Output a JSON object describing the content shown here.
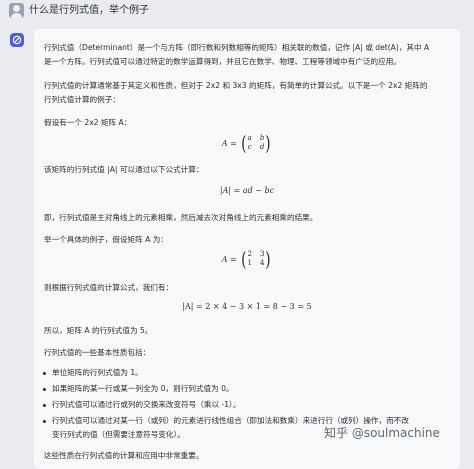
{
  "user_message": "什么是行列式值，举个例子",
  "response": {
    "intro_line1": "行列式值（Determinant）是一个与方阵（即行数和列数相等的矩阵）相关联的数值，记作 |A| 或 det(A)，其中 A",
    "intro_line2": "是一个方阵。行列式值可以通过特定的数学运算得到，并且它在数学、物理、工程等领域中有广泛的应用。",
    "calc_line1": "行列式值的计算通常基于其定义和性质，但对于 2x2 和 3x3 的矩阵，有简单的计算公式。以下是一个 2x2 矩阵的",
    "calc_line2": "行列式值计算的例子：",
    "assume": "假设有一个 2x2 矩阵 A：",
    "matrix_generic": {
      "lhs": "A =",
      "a": "a",
      "b": "b",
      "c": "c",
      "d": "d"
    },
    "formula_intro": "该矩阵的行列式值 |A| 可以通过以下公式计算：",
    "formula_generic": "|A| = ad − bc",
    "explain": "即，行列式值是主对角线上的元素相乘，然后减去次对角线上的元素相乘的结果。",
    "example_intro": "举一个具体的例子，假设矩阵 A 为：",
    "matrix_example": {
      "lhs": "A =",
      "a": "2",
      "b": "3",
      "c": "1",
      "d": "4"
    },
    "calc_intro": "则根据行列式值的计算公式，我们有：",
    "formula_example": "|A| = 2 × 4 − 3 × 1 = 8 − 3 = 5",
    "conclusion": "所以，矩阵 A 的行列式值为 5。",
    "properties_intro": "行列式值的一些基本性质包括：",
    "properties": [
      "单位矩阵的行列式值为 1。",
      "如果矩阵的某一行或某一列全为 0，则行列式值为 0。",
      "行列式值可以通过行或列的交换来改变符号（乘以 -1）。",
      "行列式值可以通过对某一行（或列）的元素进行线性组合（即加法和数乘）来进行行（或列）操作，而不改",
      "变行列式的值（但需要注意符号变化）。"
    ],
    "closing": "这些性质在行列式值的计算和应用中非常重要。"
  },
  "watermark": "知乎 @soulmachine",
  "colors": {
    "background": "#e9ebf1",
    "card": "#f8f9fb",
    "assistant_accent": "#4c5cf0"
  }
}
